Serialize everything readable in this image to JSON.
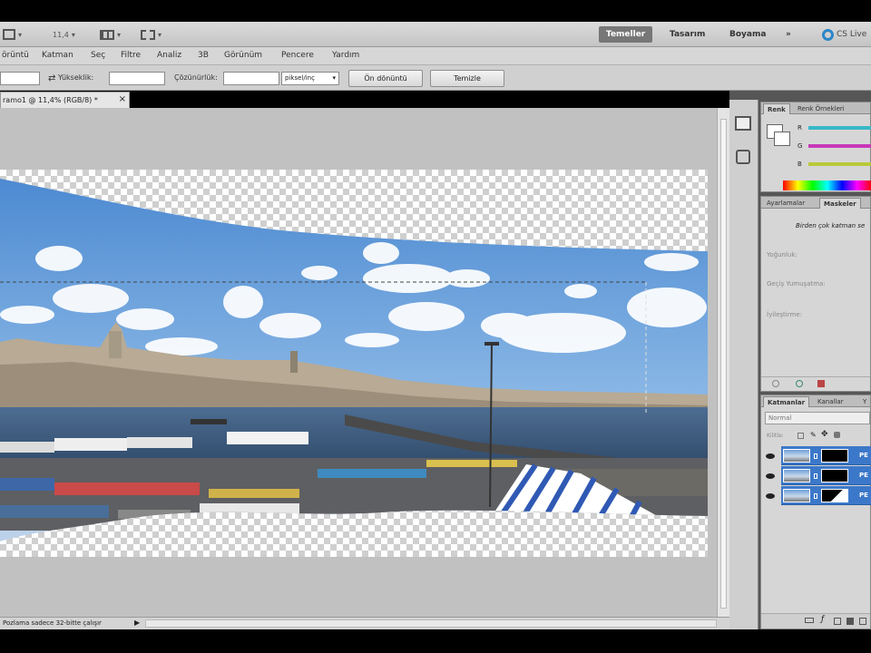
{
  "appbar": {
    "zoom_label": "11,4",
    "workspaces": [
      "Temeller",
      "Tasarım",
      "Boyama"
    ],
    "more_label": "»",
    "cslive_label": "CS Live"
  },
  "menu": [
    "örüntü",
    "Katman",
    "Seç",
    "Filtre",
    "Analiz",
    "3B",
    "Görünüm",
    "Pencere",
    "Yardım"
  ],
  "options": {
    "height_label": "Yükseklik:",
    "resolution_label": "Çözünürlük:",
    "unit_select": "piksel/inç",
    "front_image_button": "Ön dönüntü",
    "clear_button": "Temizle"
  },
  "document": {
    "tab_title": "ramo1 @ 11,4% (RGB/8) *",
    "close_label": "×"
  },
  "status": {
    "text": "Pozlama sadece 32-bitte çalışır",
    "arrow": "▶"
  },
  "panels": {
    "color": {
      "tabs": [
        "Renk",
        "Renk Örnekleri"
      ],
      "channels": [
        "R",
        "G",
        "B"
      ]
    },
    "adjust": {
      "tabs": [
        "Ayarlamalar",
        "Maskeler"
      ],
      "hint": "Birden çok katman se",
      "labels": [
        "Yoğunluk:",
        "Geçiş Yumuşatma:",
        "İyileştirme:"
      ]
    },
    "layers": {
      "tabs": [
        "Katmanlar",
        "Kanallar",
        "Y"
      ],
      "blend_mode": "Normal",
      "lock_label": "Kilitle:",
      "layer_labels": [
        "PE",
        "PE",
        "PE"
      ]
    }
  },
  "colors": {
    "accent": "#3c78c9",
    "red_slider": "#38b8c8",
    "green_slider": "#c838b8",
    "blue_slider": "#b8c838"
  }
}
